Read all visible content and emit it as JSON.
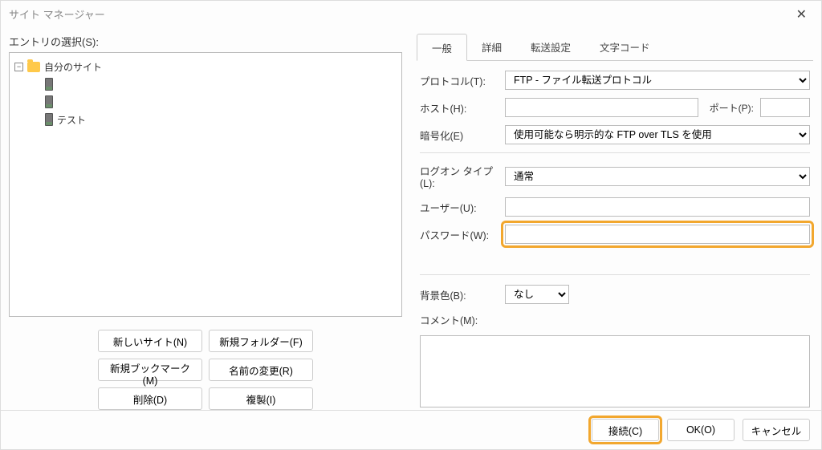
{
  "window": {
    "title": "サイト マネージャー"
  },
  "left": {
    "selectLabel": "エントリの選択(S):",
    "tree": {
      "root": "自分のサイト",
      "items": [
        "",
        "",
        "テスト"
      ]
    },
    "buttons": {
      "newSite": "新しいサイト(N)",
      "newFolder": "新規フォルダー(F)",
      "newBookmark": "新規ブックマーク(M)",
      "rename": "名前の変更(R)",
      "delete": "削除(D)",
      "duplicate": "複製(I)"
    }
  },
  "tabs": {
    "general": "一般",
    "advanced": "詳細",
    "transfer": "転送設定",
    "charset": "文字コード"
  },
  "form": {
    "protocolLabel": "プロトコル(T):",
    "protocolValue": "FTP - ファイル転送プロトコル",
    "hostLabel": "ホスト(H):",
    "hostValue": "",
    "portLabel": "ポート(P):",
    "portValue": "",
    "encryptionLabel": "暗号化(E)",
    "encryptionValue": "使用可能なら明示的な FTP over TLS を使用",
    "logonLabel": "ログオン タイプ(L):",
    "logonValue": "通常",
    "userLabel": "ユーザー(U):",
    "userValue": "",
    "passwordLabel": "パスワード(W):",
    "passwordValue": "",
    "bgLabel": "背景色(B):",
    "bgValue": "なし",
    "commentLabel": "コメント(M):",
    "commentValue": ""
  },
  "footer": {
    "connect": "接続(C)",
    "ok": "OK(O)",
    "cancel": "キャンセル"
  }
}
